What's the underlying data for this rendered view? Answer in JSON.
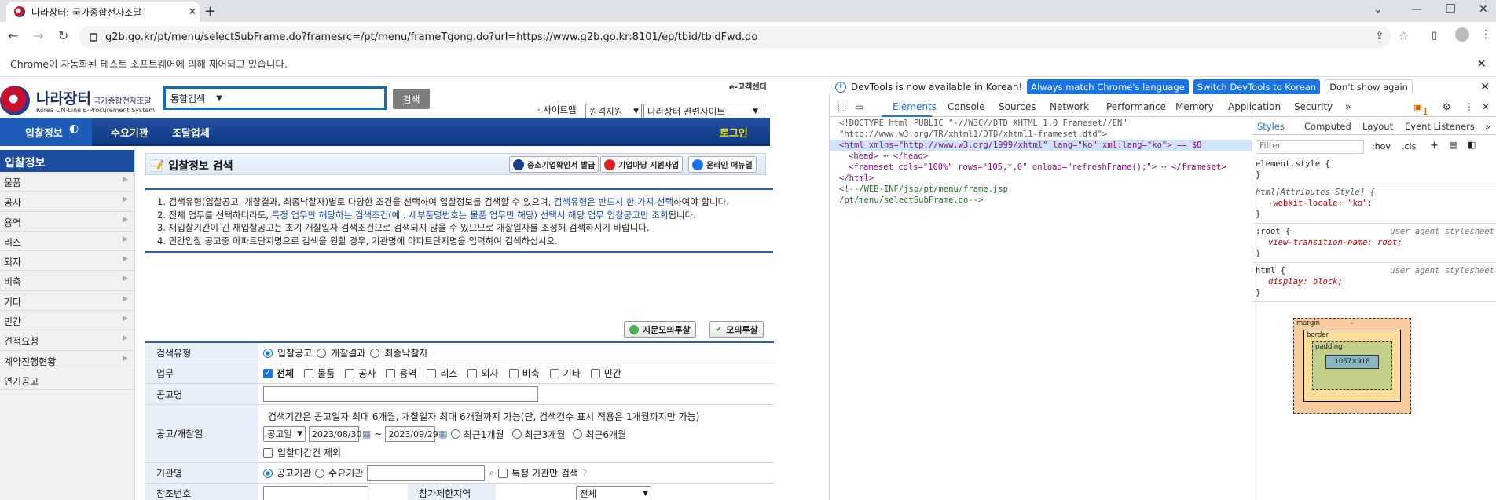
{
  "browser": {
    "tab_title": "나라장터: 국가종합전자조달",
    "url": "g2b.go.kr/pt/menu/selectSubFrame.do?framesrc=/pt/menu/frameTgong.do?url=https://www.g2b.go.kr:8101/ep/tbid/tbidFwd.do",
    "infobar": "Chrome이 자동화된 테스트 소프트웨어에 의해 제어되고 있습니다."
  },
  "header": {
    "logo_ko": "나라장터",
    "logo_sub": "국가종합전자조달",
    "logo_en": "Korea ON-Line E-Procurement System",
    "search_scope": "통합검색",
    "search_button": "검색",
    "ecs": "e-고객센터",
    "sitemap": "· 사이트맵",
    "select_remote": "원격지원",
    "select_related": "나라장터 관련사이트"
  },
  "gnb": [
    "입찰정보",
    "수요기관",
    "조달업체"
  ],
  "gnb_login": "로그인",
  "lnb": {
    "title": "입찰정보",
    "items": [
      "물품",
      "공사",
      "용역",
      "리스",
      "외자",
      "비축",
      "기타",
      "민간",
      "견적요청",
      "계약진행현황",
      "연기공고"
    ]
  },
  "page_title": "입찰정보 검색",
  "title_buttons": [
    "중소기업확인서 발급",
    "기업마당 지원사업",
    "온라인 매뉴얼"
  ],
  "guide": {
    "l1a": "1. 검색유형(입찰공고, 개찰결과, 최종낙찰자)별로 다양한 조건을 선택하여 입찰정보를 검색할 수 있으며, ",
    "l1b": "검색유형은 반드시 한 가지 선택",
    "l1c": "하여야 합니다.",
    "l2a": "2. 전체 업무를 선택하더라도, ",
    "l2b": "특정 업무만 해당하는 검색조건(예 : 세부품명번호는 물품 업무만 해당) 선택시 해당 업무 입찰공고만 조회",
    "l2c": "됩니다.",
    "l3": "3. 재입찰기간이 긴 재입찰공고는 초기 개찰일자 검색조건으로 검색되지 않을 수 있으므로 개찰일자를 조정해 검색하시기 바랍니다.",
    "l4": "4. 민간입찰 공고중 아파트단지명으로 검색을 원할 경우, 기관명에 아파트단지명을 입력하여 검색하십시오."
  },
  "action_buttons": [
    "지문모의투찰",
    "모의투찰"
  ],
  "form": {
    "type_label": "검색유형",
    "type_options": [
      "입찰공고",
      "개찰결과",
      "최종낙찰자"
    ],
    "biz_label": "업무",
    "biz_options": [
      "전체",
      "물품",
      "공사",
      "용역",
      "리스",
      "외자",
      "비축",
      "기타",
      "민간"
    ],
    "notice_label": "공고명",
    "date_label": "공고/개찰일",
    "date_note": "검색기간은 공고일자 최대 6개월, 개찰일자 최대 6개월까지 가능(단, 검색건수 표시 적용은 1개월까지만 가능)",
    "date_type": "공고일",
    "date_from": "2023/08/30",
    "date_tilde": "~",
    "date_to": "2023/09/29",
    "periods": [
      "최근1개월",
      "최근3개월",
      "최근6개월"
    ],
    "exclude_closed": "입찰마감건 제외",
    "org_label": "기관명",
    "org_options": [
      "공고기관",
      "수요기관"
    ],
    "org_specific": "특정 기관만 검색",
    "ref_label": "참조번호",
    "region_label": "참가제한지역",
    "region_value": "전체"
  },
  "devtools": {
    "info_text": "DevTools is now available in Korean!",
    "btn_match": "Always match Chrome's language",
    "btn_switch": "Switch DevTools to Korean",
    "btn_dont": "Don't show again",
    "tabs": [
      "Elements",
      "Console",
      "Sources",
      "Network",
      "Performance",
      "Memory",
      "Application",
      "Security",
      "»"
    ],
    "issues_count": "1",
    "dom": {
      "l1": "<!DOCTYPE html PUBLIC \"-//W3C//DTD XHTML 1.0 Frameset//EN\"",
      "l2": "\"http://www.w3.org/TR/xhtml1/DTD/xhtml1-frameset.dtd\">",
      "l3": "<html xmlns=\"http://www.w3.org/1999/xhtml\" lang=\"ko\" xml:lang=\"ko\"> == $0",
      "l4": "<head> ⋯ </head>",
      "l5": "<frameset cols=\"100%\" rows=\"105,*,0\" onload=\"refreshFrame();\"> ⋯ </frameset>",
      "l6": "</html>",
      "l7": "<!--/WEB-INF/jsp/pt/menu/frame.jsp",
      "l8": "/pt/menu/selectSubFrame.do-->"
    },
    "style_tabs": [
      "Styles",
      "Computed",
      "Layout",
      "Event Listeners",
      "»"
    ],
    "filter": "Filter",
    "hov": ":hov",
    "cls": ".cls",
    "rules": {
      "r1": "element.style {",
      "r2": "html[Attributes Style] {",
      "r2p": "-webkit-locale: \"ko\";",
      "r3": ":root {",
      "r3p": "view-transition-name: root;",
      "r4": "html {",
      "r4p": "display: block;",
      "close": "}",
      "ua": "user agent stylesheet"
    },
    "box": {
      "margin": "margin",
      "border": "border",
      "padding": "padding",
      "content": "1057×918",
      "dash": "–"
    }
  }
}
